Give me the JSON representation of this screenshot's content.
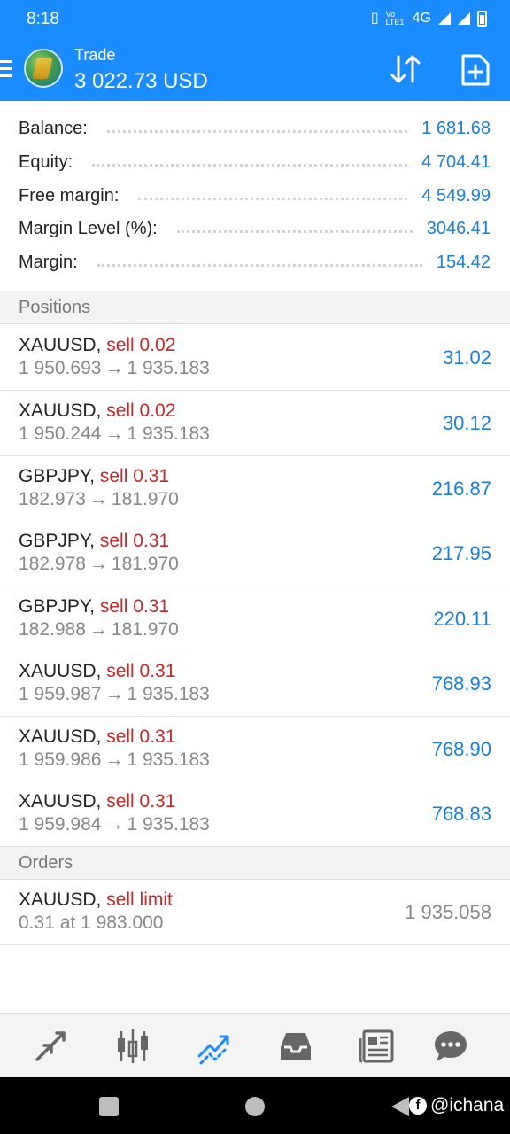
{
  "status_bar": {
    "time": "8:18",
    "network": "4G",
    "volte": "Vo LTE1"
  },
  "header": {
    "subtitle": "Trade",
    "amount": "3 022.73 USD"
  },
  "summary": [
    {
      "label": "Balance:",
      "value": "1 681.68"
    },
    {
      "label": "Equity:",
      "value": "4 704.41"
    },
    {
      "label": "Free margin:",
      "value": "4 549.99"
    },
    {
      "label": "Margin Level (%):",
      "value": "3046.41"
    },
    {
      "label": "Margin:",
      "value": "154.42"
    }
  ],
  "positions_header": "Positions",
  "positions": [
    {
      "symbol": "XAUUSD,",
      "side": "sell 0.02",
      "open": "1 950.693",
      "arrow": "→",
      "current": "1 935.183",
      "profit": "31.02"
    },
    {
      "symbol": "XAUUSD,",
      "side": "sell 0.02",
      "open": "1 950.244",
      "arrow": "→",
      "current": "1 935.183",
      "profit": "30.12"
    },
    {
      "symbol": "GBPJPY,",
      "side": "sell 0.31",
      "open": "182.973",
      "arrow": "→",
      "current": "181.970",
      "profit": "216.87"
    },
    {
      "symbol": "GBPJPY,",
      "side": "sell 0.31",
      "open": "182.978",
      "arrow": "→",
      "current": "181.970",
      "profit": "217.95"
    },
    {
      "symbol": "GBPJPY,",
      "side": "sell 0.31",
      "open": "182.988",
      "arrow": "→",
      "current": "181.970",
      "profit": "220.11"
    },
    {
      "symbol": "XAUUSD,",
      "side": "sell 0.31",
      "open": "1 959.987",
      "arrow": "→",
      "current": "1 935.183",
      "profit": "768.93"
    },
    {
      "symbol": "XAUUSD,",
      "side": "sell 0.31",
      "open": "1 959.986",
      "arrow": "→",
      "current": "1 935.183",
      "profit": "768.90"
    },
    {
      "symbol": "XAUUSD,",
      "side": "sell 0.31",
      "open": "1 959.984",
      "arrow": "→",
      "current": "1 935.183",
      "profit": "768.83"
    }
  ],
  "orders_header": "Orders",
  "orders": [
    {
      "symbol": "XAUUSD,",
      "side": "sell limit",
      "detail": "0.31 at 1 983.000",
      "price": "1 935.058"
    }
  ],
  "bottom_nav": [
    {
      "name": "quotes",
      "icon": "arrows-icon"
    },
    {
      "name": "chart",
      "icon": "candlestick-icon"
    },
    {
      "name": "trade",
      "icon": "trend-icon",
      "active": true
    },
    {
      "name": "history",
      "icon": "inbox-icon"
    },
    {
      "name": "news",
      "icon": "newspaper-icon"
    },
    {
      "name": "chat",
      "icon": "chat-icon"
    }
  ],
  "watermark": "@ichana",
  "colors": {
    "header_blue": "#1a8cff",
    "value_blue": "#1a7fd6",
    "sell_red": "#c62828"
  }
}
